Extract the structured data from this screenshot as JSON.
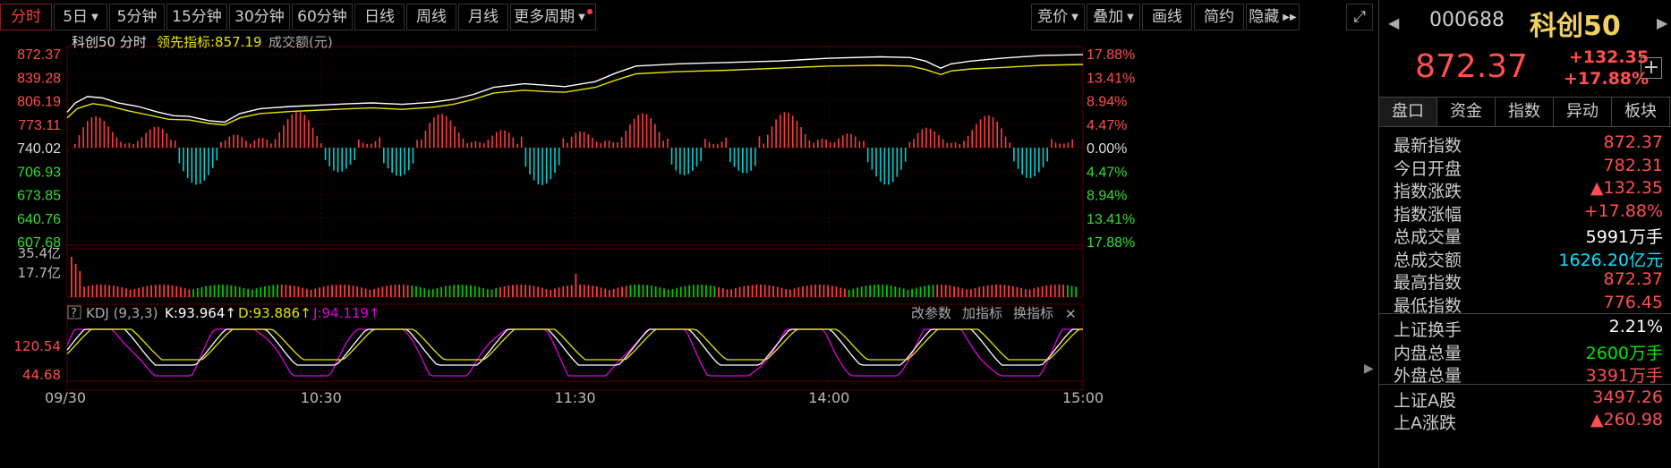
{
  "toolbar": {
    "tabs": [
      {
        "label": "分时",
        "active": true,
        "dropdown": false
      },
      {
        "label": "5日",
        "active": false,
        "dropdown": true
      },
      {
        "label": "5分钟",
        "active": false,
        "dropdown": false
      },
      {
        "label": "15分钟",
        "active": false,
        "dropdown": false
      },
      {
        "label": "30分钟",
        "active": false,
        "dropdown": false
      },
      {
        "label": "60分钟",
        "active": false,
        "dropdown": false
      },
      {
        "label": "日线",
        "active": false,
        "dropdown": false
      },
      {
        "label": "周线",
        "active": false,
        "dropdown": false
      },
      {
        "label": "月线",
        "active": false,
        "dropdown": false
      },
      {
        "label": "更多周期",
        "active": false,
        "dropdown": true
      }
    ],
    "right_buttons": [
      {
        "label": "竞价",
        "dropdown": true
      },
      {
        "label": "叠加",
        "dropdown": true
      },
      {
        "label": "画线",
        "dropdown": false
      },
      {
        "label": "简约",
        "dropdown": false
      },
      {
        "label": "隐藏",
        "dropdown": false
      }
    ]
  },
  "chart_data": {
    "type": "line",
    "legend": {
      "name": "科创50",
      "mode": "分时",
      "lead_label": "领先指标:",
      "lead_value": "857.19",
      "volume_label": "成交额(元)"
    },
    "prev_close": 740.02,
    "y_left_ticks": [
      "872.37",
      "839.28",
      "806.19",
      "773.11",
      "740.02",
      "706.93",
      "673.85",
      "640.76",
      "607.68"
    ],
    "y_right_ticks": [
      "17.88%",
      "13.41%",
      "8.94%",
      "4.47%",
      "0.00%",
      "4.47%",
      "8.94%",
      "13.41%",
      "17.88%"
    ],
    "ylim": [
      607.68,
      872.37
    ],
    "x_ticks": [
      "09/30",
      "10:30",
      "11:30",
      "14:00",
      "15:00"
    ],
    "price_path": [
      [
        0,
        790
      ],
      [
        0.008,
        803
      ],
      [
        0.02,
        812
      ],
      [
        0.035,
        810
      ],
      [
        0.05,
        803
      ],
      [
        0.07,
        798
      ],
      [
        0.09,
        790
      ],
      [
        0.105,
        785
      ],
      [
        0.12,
        784
      ],
      [
        0.14,
        778
      ],
      [
        0.155,
        776
      ],
      [
        0.17,
        788
      ],
      [
        0.19,
        795
      ],
      [
        0.22,
        798
      ],
      [
        0.25,
        800
      ],
      [
        0.28,
        802
      ],
      [
        0.3,
        803
      ],
      [
        0.33,
        801
      ],
      [
        0.36,
        804
      ],
      [
        0.38,
        808
      ],
      [
        0.4,
        815
      ],
      [
        0.42,
        825
      ],
      [
        0.45,
        830
      ],
      [
        0.47,
        828
      ],
      [
        0.49,
        826
      ],
      [
        0.52,
        833
      ],
      [
        0.54,
        845
      ],
      [
        0.56,
        855
      ],
      [
        0.6,
        858
      ],
      [
        0.65,
        860
      ],
      [
        0.7,
        862
      ],
      [
        0.75,
        866
      ],
      [
        0.8,
        868
      ],
      [
        0.83,
        867
      ],
      [
        0.845,
        862
      ],
      [
        0.86,
        852
      ],
      [
        0.87,
        858
      ],
      [
        0.89,
        862
      ],
      [
        0.92,
        866
      ],
      [
        0.96,
        870
      ],
      [
        1.0,
        871
      ]
    ],
    "lead_path": [
      [
        0,
        782
      ],
      [
        0.01,
        795
      ],
      [
        0.025,
        802
      ],
      [
        0.04,
        799
      ],
      [
        0.06,
        792
      ],
      [
        0.08,
        786
      ],
      [
        0.1,
        780
      ],
      [
        0.12,
        779
      ],
      [
        0.14,
        774
      ],
      [
        0.155,
        772
      ],
      [
        0.17,
        782
      ],
      [
        0.19,
        788
      ],
      [
        0.22,
        791
      ],
      [
        0.25,
        793
      ],
      [
        0.28,
        795
      ],
      [
        0.3,
        796
      ],
      [
        0.33,
        794
      ],
      [
        0.36,
        797
      ],
      [
        0.38,
        801
      ],
      [
        0.4,
        808
      ],
      [
        0.42,
        817
      ],
      [
        0.45,
        821
      ],
      [
        0.47,
        819
      ],
      [
        0.49,
        818
      ],
      [
        0.52,
        825
      ],
      [
        0.54,
        835
      ],
      [
        0.56,
        844
      ],
      [
        0.6,
        847
      ],
      [
        0.65,
        849
      ],
      [
        0.7,
        852
      ],
      [
        0.75,
        855
      ],
      [
        0.8,
        856
      ],
      [
        0.83,
        855
      ],
      [
        0.845,
        850
      ],
      [
        0.86,
        843
      ],
      [
        0.87,
        848
      ],
      [
        0.89,
        851
      ],
      [
        0.92,
        853
      ],
      [
        0.96,
        856
      ],
      [
        1.0,
        857.19
      ]
    ],
    "volume_ticks": [
      "35.4亿",
      "17.7亿"
    ],
    "indicator": {
      "name": "KDJ (9,3,3)",
      "k_label": "K:93.964↑",
      "d_label": "D:93.886↑",
      "j_label": "J:94.119↑",
      "ticks": [
        "120.54",
        "44.68"
      ],
      "buttons": [
        "改参数",
        "加指标",
        "换指标"
      ]
    },
    "colors": {
      "price": "#ffffff",
      "lead": "#e5e500",
      "up": "#ff3b3b",
      "down": "#00d0d0",
      "vol_up": "#ff3b3b",
      "vol_down": "#00c800",
      "k": "#ffffff",
      "d": "#e5e500",
      "j": "#e000e0",
      "grid": "#3a0000"
    }
  },
  "quote": {
    "code": "000688",
    "name": "科创50",
    "price": "872.37",
    "change": "+132.35",
    "change_pct": "+17.88%",
    "tabs": [
      "盘口",
      "资金",
      "指数",
      "异动",
      "板块"
    ],
    "rows": [
      {
        "label": "最新指数",
        "value": "872.37",
        "color": "#ff4f4f"
      },
      {
        "label": "今日开盘",
        "value": "782.31",
        "color": "#ff4f4f"
      },
      {
        "label": "指数涨跌",
        "value": "▲132.35",
        "color": "#ff4f4f"
      },
      {
        "label": "指数涨幅",
        "value": "+17.88%",
        "color": "#ff4f4f"
      },
      {
        "label": "总成交量",
        "value": "5991万手",
        "color": "#ffffff"
      },
      {
        "label": "总成交额",
        "value": "1626.20亿元",
        "color": "#00e5ff"
      },
      {
        "label": "最高指数",
        "value": "872.37",
        "color": "#ff4f4f"
      },
      {
        "label": "最低指数",
        "value": "776.45",
        "color": "#ff4f4f"
      }
    ],
    "rows2": [
      {
        "label": "上证换手",
        "value": "2.21%",
        "color": "#ffffff"
      },
      {
        "label": "内盘总量",
        "value": "2600万手",
        "color": "#00e600"
      },
      {
        "label": "外盘总量",
        "value": "3391万手",
        "color": "#ff4f4f"
      }
    ],
    "rows3": [
      {
        "label": "上证A股",
        "value": "3497.26",
        "color": "#ff4f4f"
      },
      {
        "label": "上A涨跌",
        "value": "▲260.98",
        "color": "#ff4f4f"
      }
    ]
  }
}
